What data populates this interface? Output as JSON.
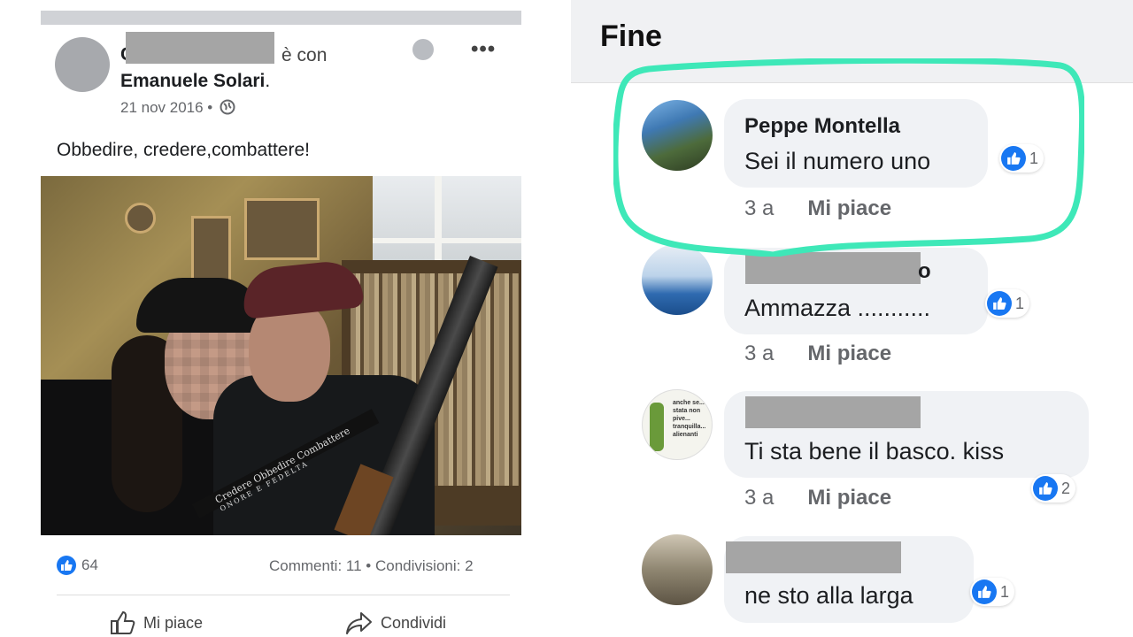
{
  "post": {
    "author_first_initial": "C",
    "with_text": "è con",
    "tagged_name": "Emanuele Solari",
    "tagged_suffix": ".",
    "date": "21 nov 2016 •",
    "text": "Obbedire, credere,combattere!",
    "photo_caption": "Credere Obbedire Combattere",
    "photo_caption2": "ONORE E FEDELTA",
    "likes": "64",
    "comments_label": "Commenti: 11",
    "dot": "•",
    "shares_label": "Condivisioni: 2",
    "like_action": "Mi piace",
    "share_action": "Condividi",
    "more": "•••"
  },
  "comments_panel": {
    "title": "Fine",
    "highlight_color": "#3ee8b8",
    "accent": "#1877f2",
    "comments": [
      {
        "name": "Peppe Montella",
        "text": "Sei il numero uno",
        "age": "3 a",
        "like": "Mi piace",
        "reactions": "1"
      },
      {
        "name": "",
        "name_tail": "o",
        "text": "Ammazza ...........",
        "age": "3 a",
        "like": "Mi piace",
        "reactions": "1"
      },
      {
        "name": "",
        "text": "Ti sta bene il basco.  kiss",
        "age": "3 a",
        "like": "Mi piace",
        "reactions": "2",
        "avatar_text": "anche se... stata non pive... tranquilla... alienanti"
      },
      {
        "name": "",
        "text": "ne sto alla larga",
        "age": "3 a",
        "like": "Mi piace",
        "reactions": "1"
      }
    ]
  }
}
